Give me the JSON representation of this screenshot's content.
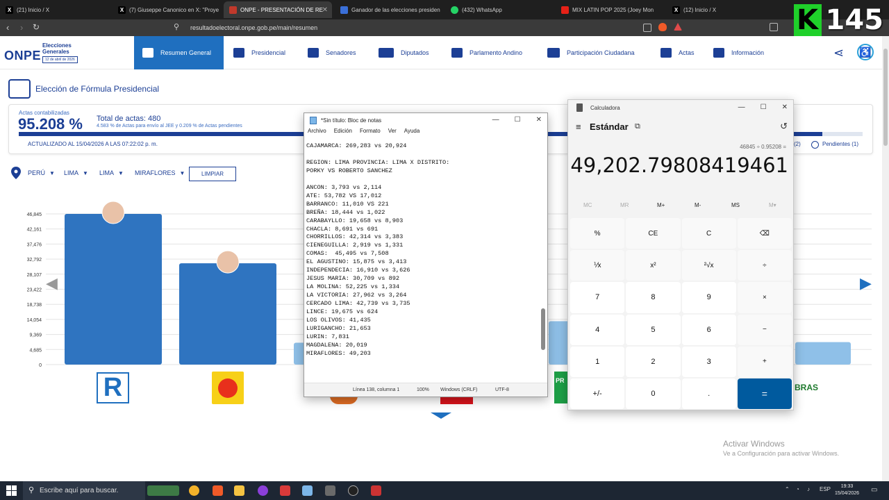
{
  "browser": {
    "tabs": [
      {
        "label": "(21) Inicio / X",
        "icon": "x-logo-icon"
      },
      {
        "label": "(7) Giuseppe Canonico en X: \"Proye",
        "icon": "x-logo-icon"
      },
      {
        "label": "ONPE - PRESENTACIÓN DE RE",
        "icon": "onpe-icon",
        "active": true
      },
      {
        "label": "Ganador de las elecciones presiden",
        "icon": "doc-icon"
      },
      {
        "label": "(432) WhatsApp",
        "icon": "whatsapp-icon"
      },
      {
        "label": "MIX LATIN POP 2025 (Joey Mon",
        "icon": "youtube-icon"
      },
      {
        "label": "(12) Inicio / X",
        "icon": "x-logo-icon"
      }
    ],
    "url": "resultadoelectoral.onpe.gob.pe/main/resumen",
    "overlay_badge": "145"
  },
  "onpe": {
    "logo": "ONPE",
    "logo_sub1": "Elecciones",
    "logo_sub2": "Generales",
    "logo_date": "12 de abril de 2026",
    "menu": [
      "Resumen General",
      "Presidencial",
      "Senadores",
      "Diputados",
      "Parlamento Andino",
      "Participación Ciudadana",
      "Actas",
      "Información"
    ],
    "page_title": "Elección de Fórmula Presidencial",
    "actas_label": "Actas contabilizadas",
    "actas_pct": "95.208 %",
    "actas_pct_value": 95.208,
    "total_actas": "Total de actas: 480",
    "actas_note": "4.583 % de Actas para envío al JEE y 0.209 % de Actas pendientes",
    "updated": "ACTUALIZADO AL 15/04/2026 A LAS 07:22:02 p. m.",
    "legend_fragment": "(2)",
    "legend_pending": "Pendientes (1)",
    "filters": [
      "PERÚ",
      "LIMA",
      "LIMA",
      "MIRAFLORES"
    ],
    "clear_button": "LIMPIAR"
  },
  "chart_data": {
    "type": "bar",
    "yticks": [
      "46,845",
      "42,161",
      "37,476",
      "32,792",
      "28,107",
      "23,422",
      "18,738",
      "14,054",
      "9,369",
      "4,685",
      "0"
    ],
    "ylim": [
      0,
      46845
    ],
    "categories": [
      "R",
      "Sol"
    ],
    "values": [
      46845,
      31500
    ],
    "color": "#2f74c0",
    "partial_bars": [
      6800,
      13500,
      7000
    ]
  },
  "notepad": {
    "title": "*Sin título: Bloc de notas",
    "menu": [
      "Archivo",
      "Edición",
      "Formato",
      "Ver",
      "Ayuda"
    ],
    "lines": [
      "CAJAMARCA: 269,283 vs 20,924",
      "",
      "REGION: LIMA PROVINCIA: LIMA X DISTRITO:",
      "PORKY VS ROBERTO SANCHEZ",
      "",
      "ANCON: 3,793 vs 2,114",
      "ATE: 53,782 VS 17,012",
      "BARRANCO: 11,010 VS 221",
      "BREÑA: 18,444 vs 1,022",
      "CARABAYLLO: 19,658 vs 8,903",
      "CHACLA: 8,691 vs 691",
      "CHORRILLOS: 42,314 vs 3,383",
      "CIENEGUILLA: 2,919 vs 1,331",
      "COMAS:  45,495 vs 7,508",
      "EL AGUSTINO: 15,875 vs 3,413",
      "INDEPENDECIA: 16,910 vs 3,626",
      "JESUS MARIA: 30,709 vs 892",
      "LA MOLINA: 52,225 vs 1,334",
      "LA VICTORIA: 27,962 vs 3,264",
      "CERCADO LIMA: 42,739 vs 3,735",
      "LINCE: 19,675 vs 624",
      "LOS OLIVOS: 41,435",
      "LURIGANCHO: 21,653",
      "LURIN: 7,831",
      "MAGDALENA: 20,019",
      "MIRAFLORES: 49,203"
    ],
    "status_position": "Línea 138, columna 1",
    "status_zoom": "100%",
    "status_eol": "Windows (CRLF)",
    "status_enc": "UTF-8"
  },
  "calculator": {
    "title": "Calculadora",
    "mode": "Estándar",
    "expression": "46845 ÷ 0.95208 =",
    "result": "49,202.79808419461",
    "memory": [
      "MC",
      "MR",
      "M+",
      "M-",
      "MS",
      "M▾"
    ],
    "keys": [
      "%",
      "CE",
      "C",
      "⌫",
      "⅟x",
      "x²",
      "²√x",
      "÷",
      "7",
      "8",
      "9",
      "×",
      "4",
      "5",
      "6",
      "−",
      "1",
      "2",
      "3",
      "+",
      "+/-",
      "0",
      ".",
      "="
    ]
  },
  "watermark": {
    "line1": "Activar Windows",
    "line2": "Ve a Configuración para activar Windows."
  },
  "taskbar": {
    "search_placeholder": "Escribe aquí para buscar.",
    "lang": "ESP",
    "time": "19:33",
    "date": "15/04/2026"
  }
}
